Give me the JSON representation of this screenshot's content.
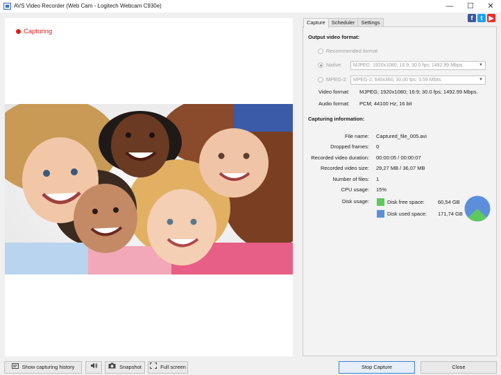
{
  "window": {
    "title": "AVS Video Recorder (Web Cam - Logitech Webcam C930e)",
    "minimize": "—",
    "maximize": "☐",
    "close": "✕"
  },
  "preview": {
    "status_label": "Capturing",
    "status_color": "#e01c1c"
  },
  "tabs": [
    {
      "label": "Capture",
      "active": true
    },
    {
      "label": "Scheduler",
      "active": false
    },
    {
      "label": "Settings",
      "active": false
    }
  ],
  "social": [
    {
      "icon": "facebook-icon",
      "glyph": "f",
      "color": "#3b5998"
    },
    {
      "icon": "twitter-icon",
      "glyph": "t",
      "color": "#1da1f2"
    },
    {
      "icon": "youtube-icon",
      "glyph": "▶",
      "color": "#e52d27"
    }
  ],
  "output_format": {
    "heading": "Output video format:",
    "recommended_label": "Recommended format",
    "native_label": "Native",
    "native_value": "MJPEG; 1920x1080; 16:9; 30.0 fps; 1492.99 Mbps.",
    "mpeg2_label": "MPEG-2",
    "mpeg2_value": "MPEG-2; 640x360; 30,00 fps; 3,59 Mbits",
    "selected": "Native",
    "video_format_label": "Video format:",
    "video_format_value": "MJPEG; 1920x1080; 16:9; 30.0 fps; 1492.99 Mbps.",
    "audio_format_label": "Audio format:",
    "audio_format_value": "PCM; 44100 Hz; 16 bit"
  },
  "capturing_info": {
    "heading": "Capturing information:",
    "rows": [
      {
        "label": "File name:",
        "value": "Captured_file_005.avi"
      },
      {
        "label": "Dropped frames:",
        "value": "0"
      },
      {
        "label": "Recorded video duration:",
        "value": "00:00:05   /   00:00:07"
      },
      {
        "label": "Recorded video size:",
        "value": "29,27 MB   /   36,07 MB"
      },
      {
        "label": "Number of files:",
        "value": "1"
      },
      {
        "label": "CPU usage:",
        "value": "15%"
      }
    ],
    "disk_usage_label": "Disk usage:",
    "disk_free_label": "Disk free space:",
    "disk_free_value": "60,54 GB",
    "disk_used_label": "Disk used space:",
    "disk_used_value": "171,74 GB",
    "disk_free_color": "#5ec85e",
    "disk_used_color": "#5b8fdc",
    "disk_free_gb": 60.54,
    "disk_used_gb": 171.74
  },
  "toolbar": {
    "history_label": "Show capturing history",
    "snapshot_label": "Snapshot",
    "fullscreen_label": "Full screen",
    "stop_label": "Stop Capture",
    "close_label": "Close"
  }
}
